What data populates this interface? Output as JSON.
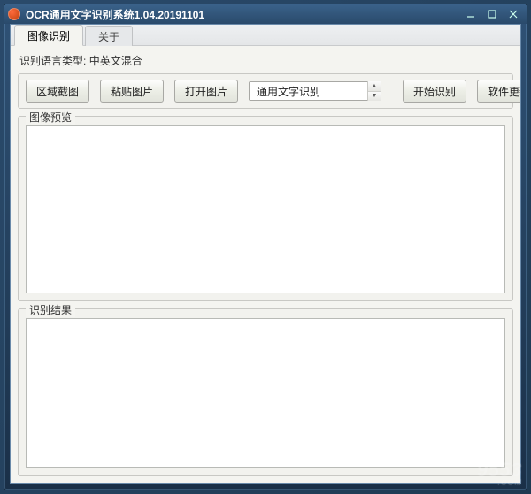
{
  "window": {
    "title": "OCR通用文字识别系统1.04.20191101"
  },
  "tabs": [
    {
      "label": "图像识别",
      "active": true
    },
    {
      "label": "关于",
      "active": false
    }
  ],
  "language": {
    "prefix": "识别语言类型:",
    "value": "中英文混合"
  },
  "toolbar": {
    "crop": "区域截图",
    "paste": "粘贴图片",
    "open": "打开图片",
    "start": "开始识别",
    "update": "软件更新",
    "mode_selected": "通用文字识别"
  },
  "preview": {
    "label": "图像预览"
  },
  "result": {
    "label": "识别结果"
  },
  "watermark": {
    "main": "9553",
    "sub": ".COM"
  }
}
